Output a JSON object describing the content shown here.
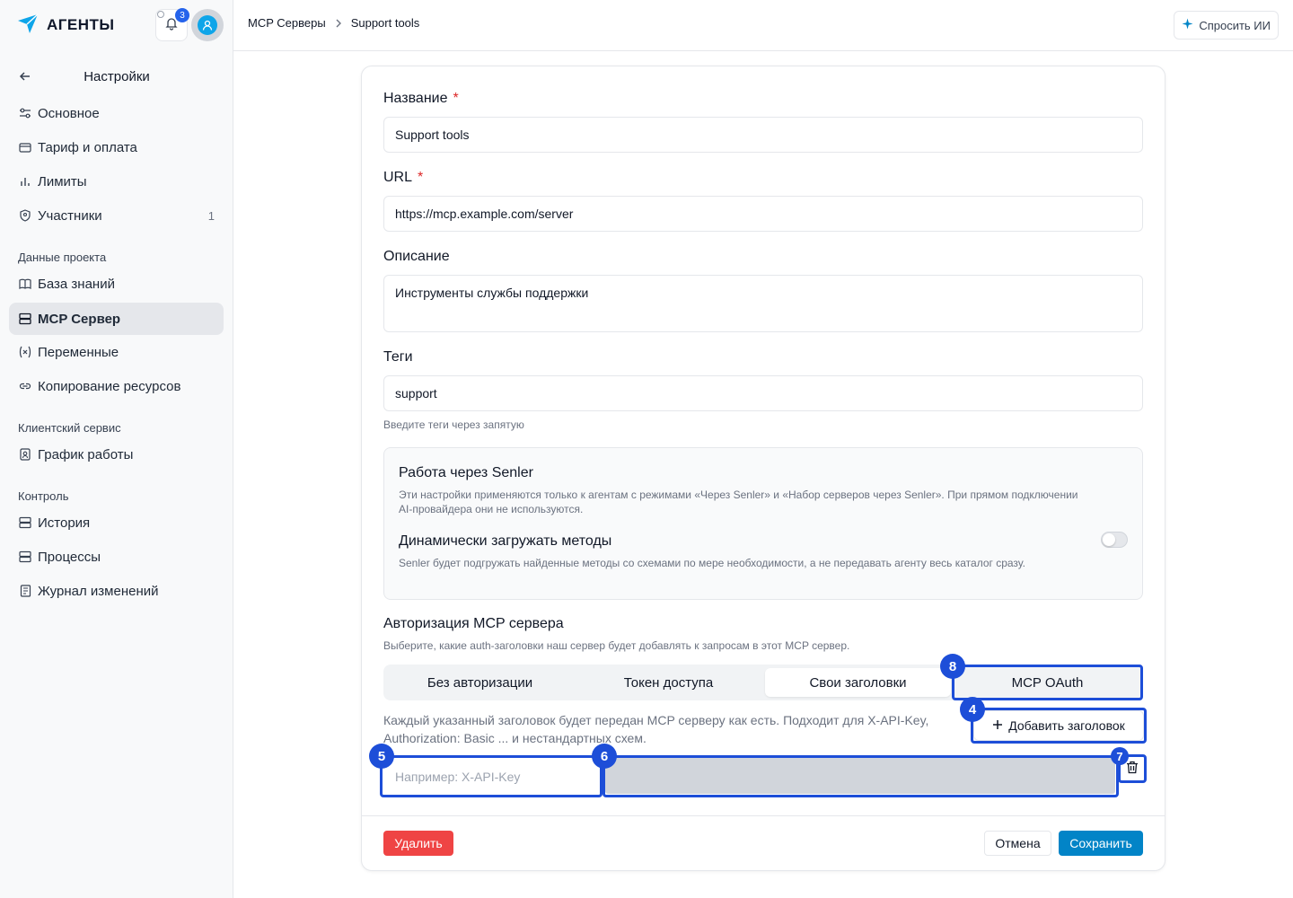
{
  "app": {
    "logo_text": "АГЕНТЫ",
    "notification_count": "3"
  },
  "breadcrumb": {
    "parent": "MCP Серверы",
    "current": "Support tools"
  },
  "ask_ai": {
    "label": "Спросить ИИ"
  },
  "sidebar": {
    "title": "Настройки",
    "items": [
      {
        "label": "Основное",
        "icon": "sliders-icon"
      },
      {
        "label": "Тариф и оплата",
        "icon": "credit-card-icon"
      },
      {
        "label": "Лимиты",
        "icon": "bar-chart-icon"
      },
      {
        "label": "Участники",
        "icon": "shield-user-icon",
        "count": "1"
      }
    ],
    "sections": [
      {
        "label": "Данные проекта",
        "items": [
          {
            "label": "База знаний",
            "icon": "book-icon"
          },
          {
            "label": "MCP Сервер",
            "icon": "server-icon",
            "active": true
          },
          {
            "label": "Переменные",
            "icon": "variable-icon"
          },
          {
            "label": "Копирование ресурсов",
            "icon": "link-icon"
          }
        ]
      },
      {
        "label": "Клиентский сервис",
        "items": [
          {
            "label": "График работы",
            "icon": "contact-icon"
          }
        ]
      },
      {
        "label": "Контроль",
        "items": [
          {
            "label": "История",
            "icon": "history-icon"
          },
          {
            "label": "Процессы",
            "icon": "server-icon"
          },
          {
            "label": "Журнал изменений",
            "icon": "log-icon"
          }
        ]
      }
    ]
  },
  "form": {
    "name": {
      "label": "Название",
      "required": "*",
      "value": "Support tools"
    },
    "url": {
      "label": "URL",
      "required": "*",
      "value": "https://mcp.example.com/server"
    },
    "description": {
      "label": "Описание",
      "value": "Инструменты службы поддержки"
    },
    "tags": {
      "label": "Теги",
      "value": "support",
      "hint": "Введите теги через запятую"
    },
    "senler": {
      "title": "Работа через Senler",
      "description": "Эти настройки применяются только к агентам с режимами «Через Senler» и «Набор серверов через Senler». При прямом подключении AI-провайдера они не используются.",
      "dynamic_title": "Динамически загружать методы",
      "dynamic_description": "Senler будет подгружать найденные методы со схемами по мере необходимости, а не передавать агенту весь каталог сразу.",
      "dynamic_enabled": false
    },
    "auth": {
      "title": "Авторизация MCP сервера",
      "description": "Выберите, какие auth-заголовки наш сервер будет добавлять к запросам в этот MCP сервер.",
      "tabs": [
        "Без авторизации",
        "Токен доступа",
        "Свои заголовки",
        "MCP OAuth"
      ],
      "active_tab": "Свои заголовки",
      "headers_description": "Каждый указанный заголовок будет передан MCP серверу как есть. Подходит для X-API-Key, Authorization: Basic ... и нестандартных схем.",
      "add_header_label": "Добавить заголовок",
      "header_name_placeholder": "Например: X-API-Key",
      "header_value": ""
    }
  },
  "markers": {
    "m4": "4",
    "m5": "5",
    "m6": "6",
    "m7": "7",
    "m8": "8"
  },
  "actions": {
    "delete": "Удалить",
    "cancel": "Отмена",
    "save": "Сохранить"
  },
  "colors": {
    "accent": "#0284c7",
    "danger": "#ef4444",
    "highlight": "#1d4ed8"
  }
}
